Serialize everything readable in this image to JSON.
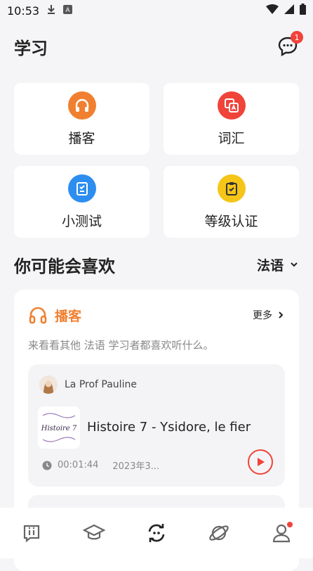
{
  "status": {
    "time": "10:53"
  },
  "header": {
    "title": "学习",
    "messages_badge": "1"
  },
  "tiles": [
    {
      "label": "播客",
      "icon": "headphones-icon",
      "color": "#f08030"
    },
    {
      "label": "词汇",
      "icon": "translate-icon",
      "color": "#f0433a"
    },
    {
      "label": "小测试",
      "icon": "quiz-icon",
      "color": "#2d8ef0"
    },
    {
      "label": "等级认证",
      "icon": "clipboard-check-icon",
      "color": "#f5c518"
    }
  ],
  "recommend": {
    "title": "你可能会喜欢",
    "language": "法语"
  },
  "podcast_card": {
    "title": "播客",
    "more": "更多",
    "description": "来看看其他 法语 学习者都喜欢听什么。",
    "episode": {
      "author": "La Prof Pauline",
      "thumb_text": "Histoire 7",
      "title": "Histoire 7 - Ysidore, le fier",
      "duration": "00:01:44",
      "date": "2023年3..."
    }
  },
  "colors": {
    "accent_orange": "#f08030",
    "accent_red": "#f0433a",
    "background": "#f5f5f7"
  }
}
